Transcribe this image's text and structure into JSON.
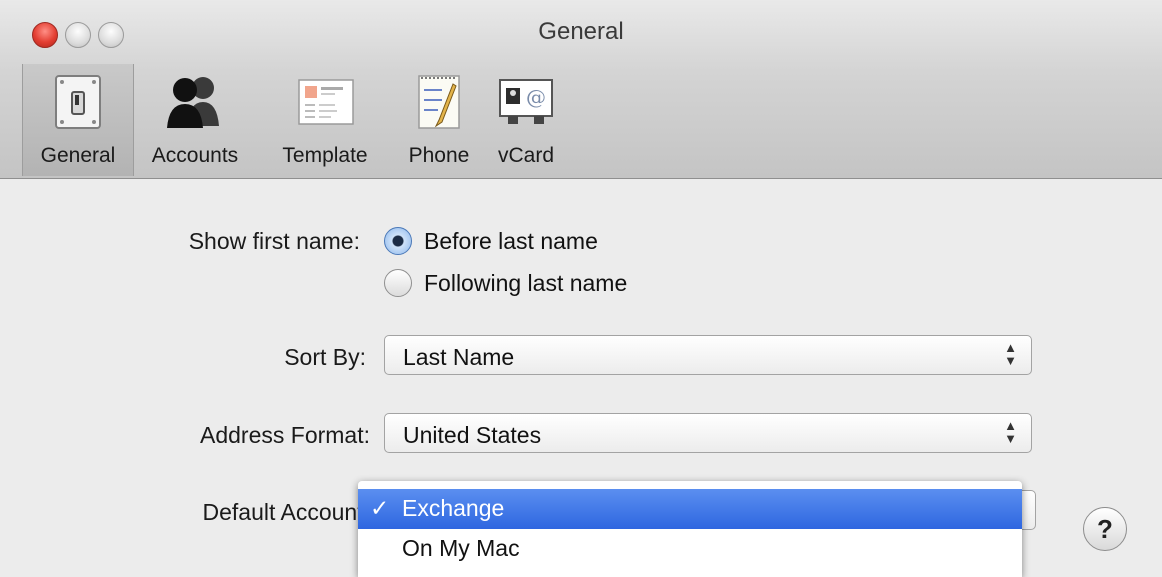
{
  "window": {
    "title": "General"
  },
  "toolbar": {
    "items": [
      {
        "label": "General",
        "icon": "switch-icon"
      },
      {
        "label": "Accounts",
        "icon": "accounts-icon"
      },
      {
        "label": "Template",
        "icon": "template-icon"
      },
      {
        "label": "Phone",
        "icon": "phone-notepad-icon"
      },
      {
        "label": "vCard",
        "icon": "vcard-icon"
      }
    ],
    "selected": "General"
  },
  "form": {
    "show_first_name": {
      "label": "Show first name:",
      "options": [
        "Before last name",
        "Following last name"
      ],
      "selected": "Before last name"
    },
    "sort_by": {
      "label": "Sort By:",
      "value": "Last Name"
    },
    "address_format": {
      "label": "Address Format:",
      "value": "United States"
    },
    "default_account": {
      "label": "Default Account:",
      "menu_options": [
        "Exchange",
        "On My Mac"
      ],
      "selected": "Exchange",
      "check_glyph": "✓"
    }
  },
  "help": {
    "label": "?"
  }
}
